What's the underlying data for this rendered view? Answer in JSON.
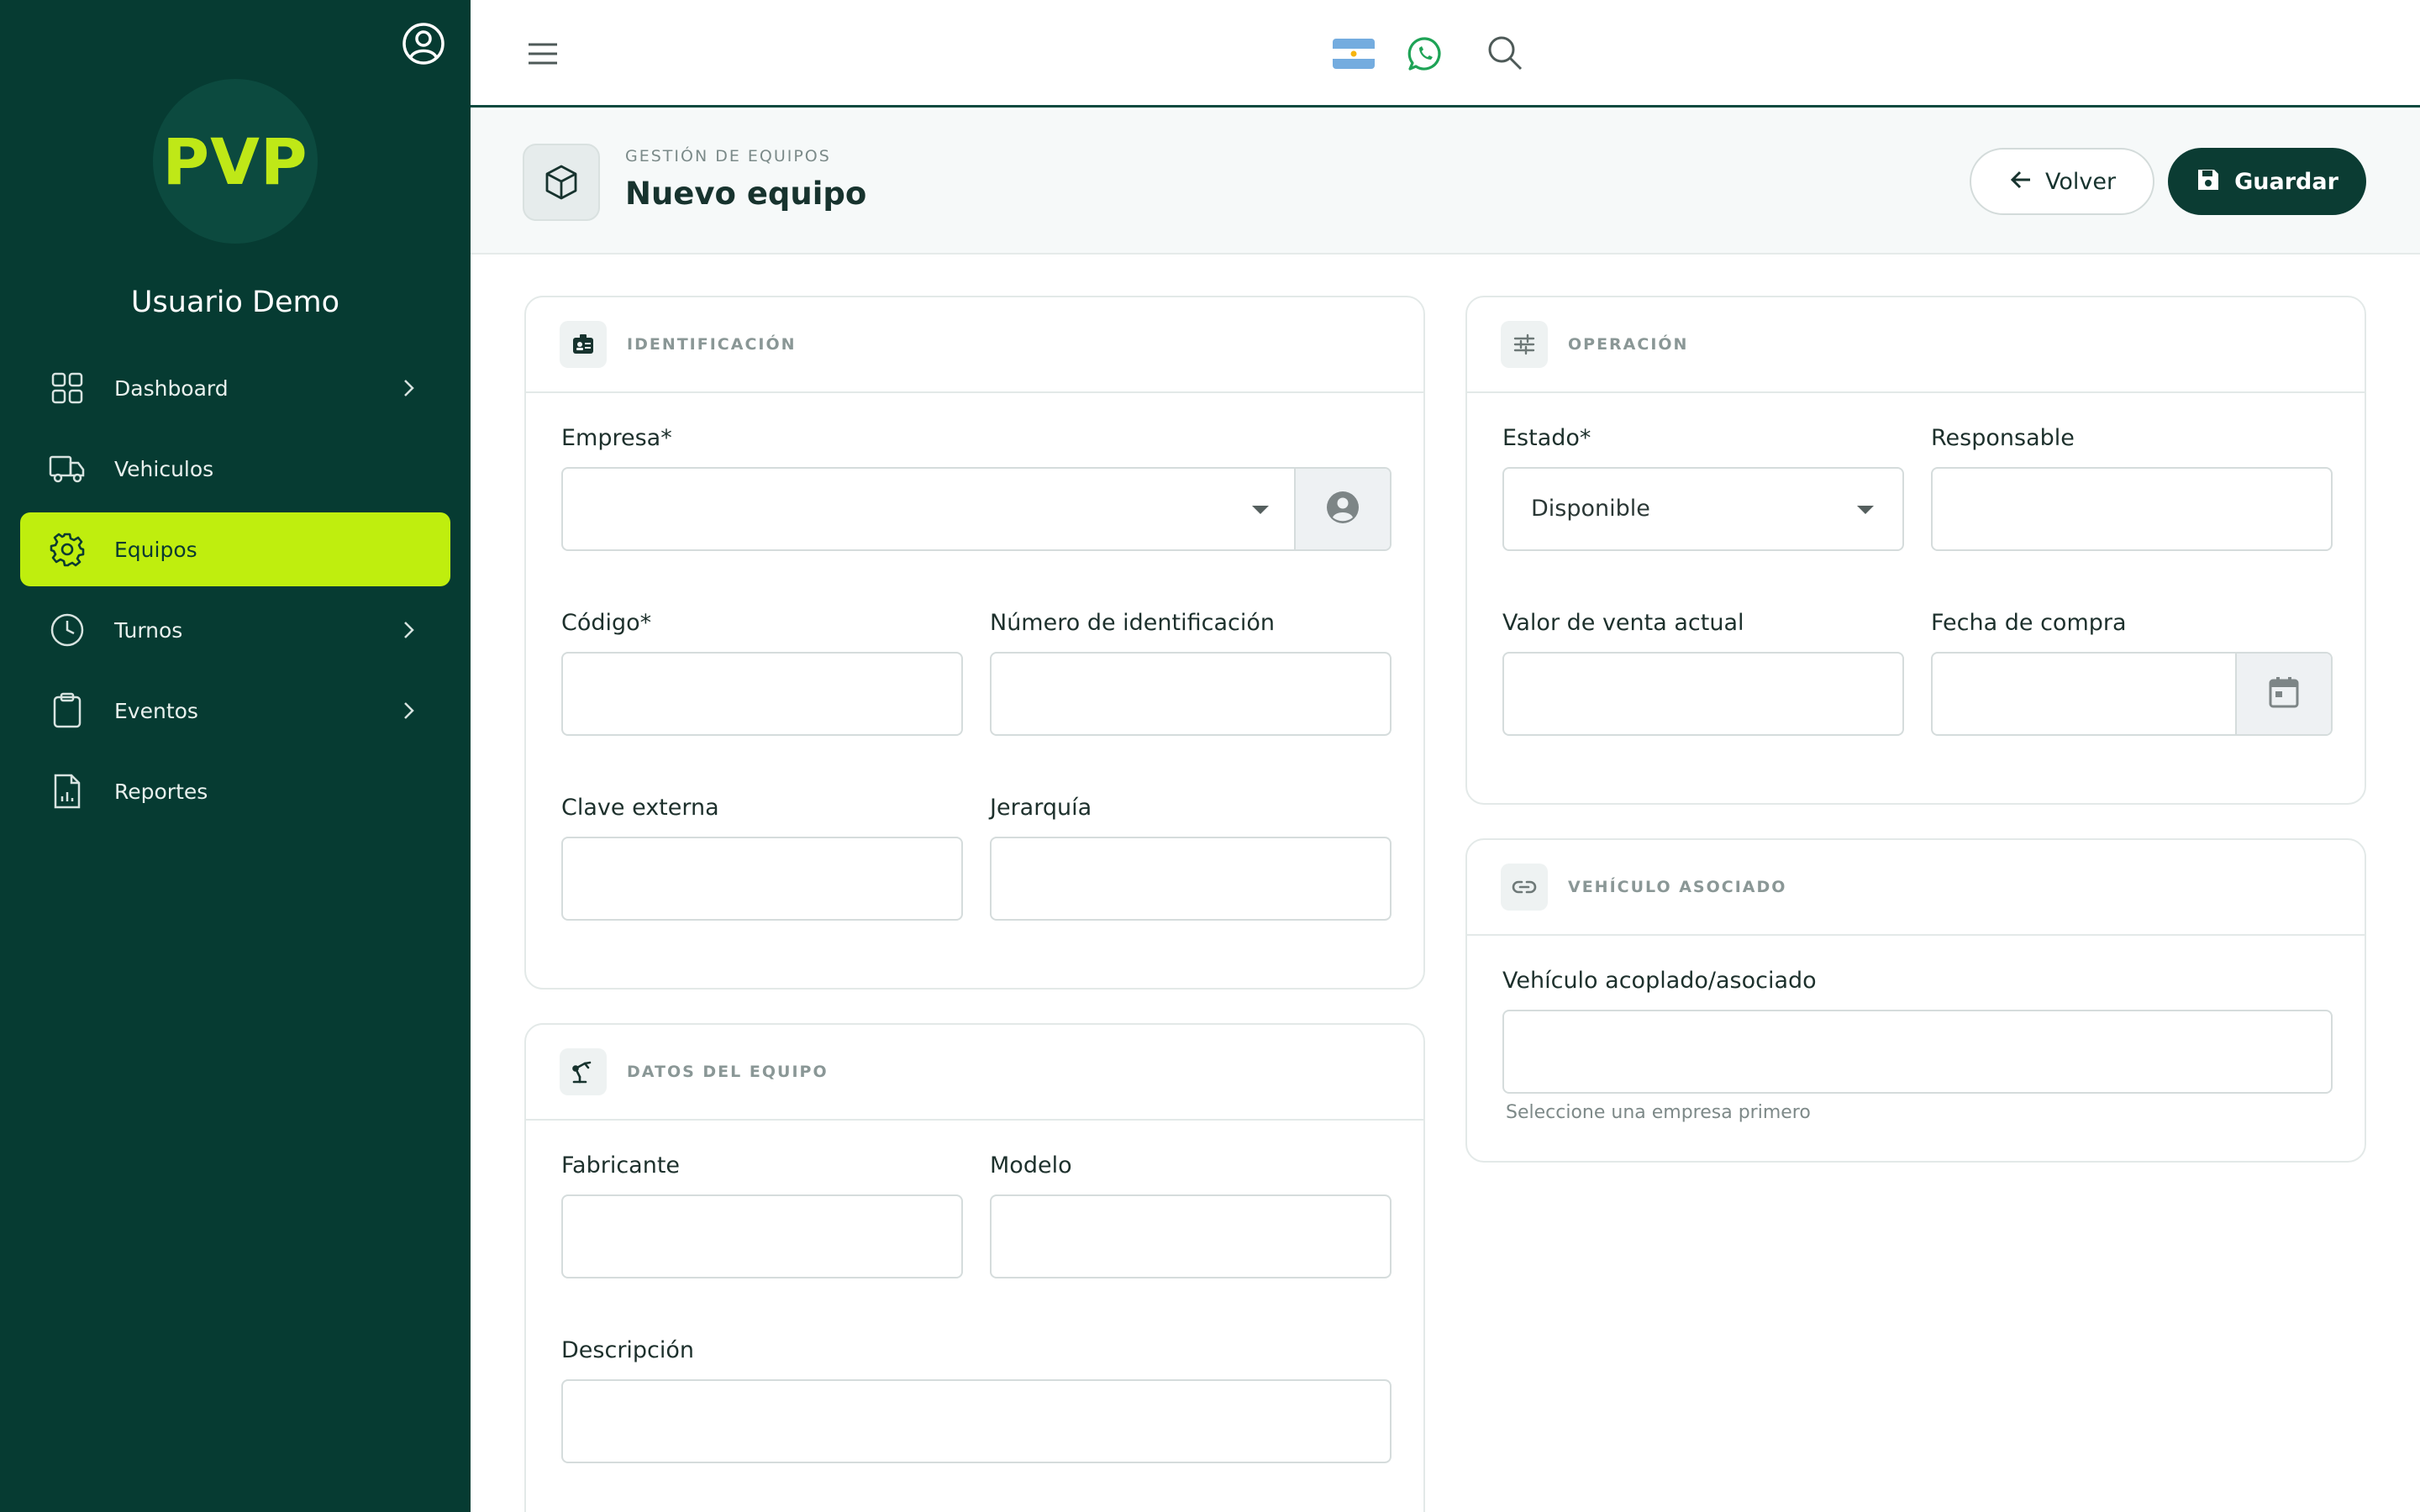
{
  "sidebar": {
    "logo_text": "PVP",
    "username": "Usuario Demo",
    "items": [
      {
        "label": "Dashboard",
        "icon": "dashboard-grid-icon",
        "has_chevron": true,
        "active": false
      },
      {
        "label": "Vehiculos",
        "icon": "truck-icon",
        "has_chevron": false,
        "active": false
      },
      {
        "label": "Equipos",
        "icon": "gear-icon",
        "has_chevron": false,
        "active": true
      },
      {
        "label": "Turnos",
        "icon": "clock-icon",
        "has_chevron": true,
        "active": false
      },
      {
        "label": "Eventos",
        "icon": "clipboard-icon",
        "has_chevron": true,
        "active": false
      },
      {
        "label": "Reportes",
        "icon": "report-file-icon",
        "has_chevron": false,
        "active": false
      }
    ]
  },
  "topbar": {
    "icons": [
      "menu-icon",
      "argentina-flag-icon",
      "whatsapp-icon",
      "search-icon"
    ]
  },
  "header": {
    "breadcrumb": "GESTIÓN DE EQUIPOS",
    "title": "Nuevo equipo",
    "back_label": "Volver",
    "save_label": "Guardar"
  },
  "identificacion": {
    "title": "IDENTIFICACIÓN",
    "empresa_label": "Empresa*",
    "empresa_value": "",
    "codigo_label": "Código*",
    "numero_label": "Número de identificación",
    "clave_label": "Clave externa",
    "jerarquia_label": "Jerarquía"
  },
  "datos": {
    "title": "DATOS DEL EQUIPO",
    "fabricante_label": "Fabricante",
    "modelo_label": "Modelo",
    "descripcion_label": "Descripción"
  },
  "operacion": {
    "title": "OPERACIÓN",
    "estado_label": "Estado*",
    "estado_value": "Disponible",
    "responsable_label": "Responsable",
    "valor_label": "Valor de venta actual",
    "fecha_label": "Fecha de compra"
  },
  "vehiculo": {
    "title": "VEHÍCULO ASOCIADO",
    "label": "Vehículo acoplado/asociado",
    "hint": "Seleccione una empresa primero"
  },
  "colors": {
    "sidebar_bg": "#063b32",
    "accent": "#bfee0e",
    "primary_button": "#0b3c33"
  }
}
